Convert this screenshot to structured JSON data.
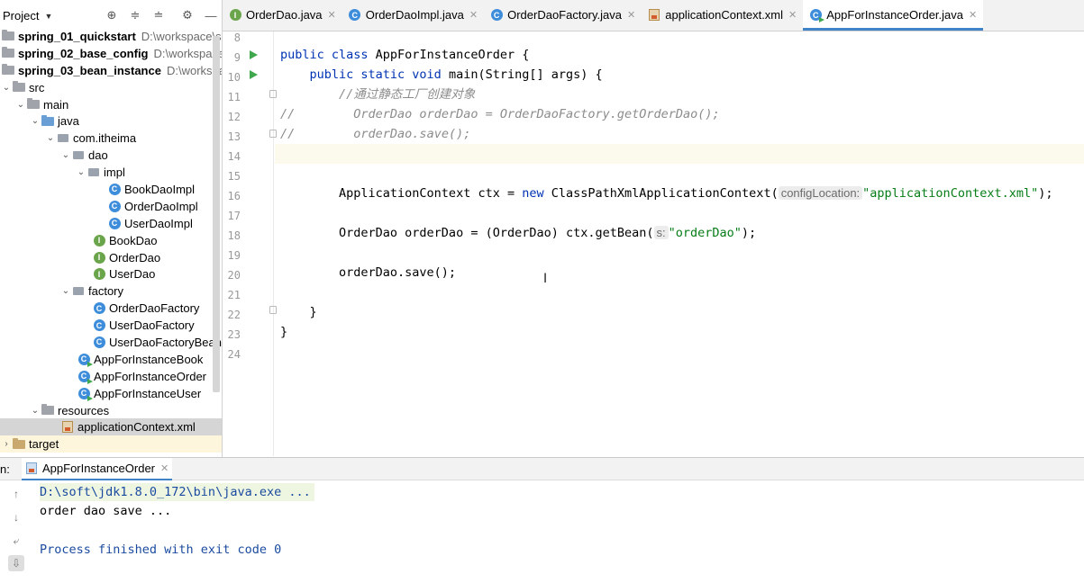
{
  "project": {
    "title": "Project",
    "modules": [
      {
        "name": "spring_01_quickstart",
        "path": "D:\\workspace\\sp"
      },
      {
        "name": "spring_02_base_config",
        "path": "D:\\workspace\\s"
      },
      {
        "name": "spring_03_bean_instance",
        "path": "D:\\workspace"
      }
    ],
    "tree": {
      "src": "src",
      "main": "main",
      "java": "java",
      "pkg": "com.itheima",
      "dao": "dao",
      "impl": "impl",
      "impl_classes": [
        "BookDaoImpl",
        "OrderDaoImpl",
        "UserDaoImpl"
      ],
      "dao_interfaces": [
        "BookDao",
        "OrderDao",
        "UserDao"
      ],
      "factory": "factory",
      "factory_classes": [
        "OrderDaoFactory",
        "UserDaoFactory",
        "UserDaoFactoryBean"
      ],
      "app_classes": [
        "AppForInstanceBook",
        "AppForInstanceOrder",
        "AppForInstanceUser"
      ],
      "resources": "resources",
      "xml_file": "applicationContext.xml",
      "target": "target"
    }
  },
  "tabs": [
    {
      "label": "OrderDao.java",
      "icon": "interface-icon"
    },
    {
      "label": "OrderDaoImpl.java",
      "icon": "class-icon"
    },
    {
      "label": "OrderDaoFactory.java",
      "icon": "class-icon"
    },
    {
      "label": "applicationContext.xml",
      "icon": "xml-icon"
    },
    {
      "label": "AppForInstanceOrder.java",
      "icon": "class-run-icon",
      "active": true
    }
  ],
  "editor": {
    "line_numbers": [
      "8",
      "9",
      "10",
      "11",
      "12",
      "13",
      "14",
      "15",
      "16",
      "17",
      "18",
      "19",
      "20",
      "21",
      "22",
      "23",
      "24"
    ],
    "lines": {
      "l9_kw": "public class ",
      "l9_rest": "AppForInstanceOrder {",
      "l10_kw": "    public static void ",
      "l10_rest": "main(String[] args) {",
      "l11": "        //通过静态工厂创建对象",
      "l12_prefix": "//",
      "l12": "        OrderDao orderDao = OrderDaoFactory.getOrderDao();",
      "l13_prefix": "//",
      "l13": "        orderDao.save();",
      "l16_a": "        ApplicationContext ctx = ",
      "l16_kw": "new",
      "l16_b": " ClassPathXmlApplicationContext(",
      "l16_hint": "configLocation:",
      "l16_str": "\"applicationContext.xml\"",
      "l16_end": ");",
      "l18_a": "        OrderDao orderDao = (OrderDao) ctx.getBean(",
      "l18_hint": "s:",
      "l18_str": "\"orderDao\"",
      "l18_end": ");",
      "l20": "        orderDao.save();",
      "l22": "    }",
      "l23": "}"
    }
  },
  "run": {
    "label": "n:",
    "tab": "AppForInstanceOrder",
    "console": [
      "D:\\soft\\jdk1.8.0_172\\bin\\java.exe ...",
      "order dao save ...",
      "",
      "Process finished with exit code 0"
    ]
  }
}
